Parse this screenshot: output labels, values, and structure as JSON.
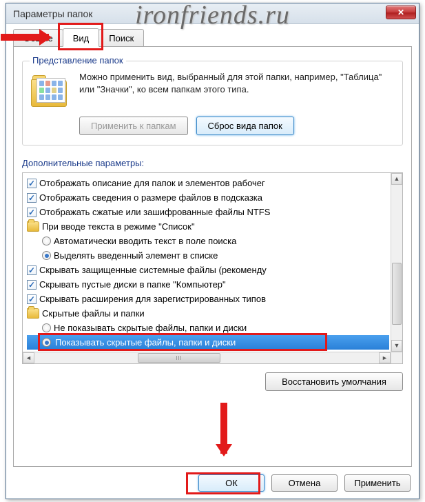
{
  "watermark": "ironfriends.ru",
  "window": {
    "title": "Параметры папок"
  },
  "tabs": {
    "general": "Общие",
    "view": "Вид",
    "search": "Поиск"
  },
  "folder_views": {
    "group_title": "Представление папок",
    "description": "Можно применить вид, выбранный для этой папки, например, \"Таблица\" или \"Значки\", ко всем папкам этого типа.",
    "apply_btn": "Применить к папкам",
    "reset_btn": "Сброс вида папок"
  },
  "advanced": {
    "label": "Дополнительные параметры:",
    "items": [
      {
        "type": "check",
        "indent": 0,
        "checked": true,
        "label": "Отображать описание для папок и элементов рабочег"
      },
      {
        "type": "check",
        "indent": 0,
        "checked": true,
        "label": "Отображать сведения о размере файлов в подсказка"
      },
      {
        "type": "check",
        "indent": 0,
        "checked": true,
        "label": "Отображать сжатые или зашифрованные файлы NTFS"
      },
      {
        "type": "folder",
        "indent": 0,
        "label": "При вводе текста в режиме \"Список\""
      },
      {
        "type": "radio",
        "indent": 1,
        "checked": false,
        "label": "Автоматически вводить текст в поле поиска"
      },
      {
        "type": "radio",
        "indent": 1,
        "checked": true,
        "label": "Выделять введенный элемент в списке"
      },
      {
        "type": "check",
        "indent": 0,
        "checked": true,
        "label": "Скрывать защищенные системные файлы (рекоменду"
      },
      {
        "type": "check",
        "indent": 0,
        "checked": true,
        "label": "Скрывать пустые диски в папке \"Компьютер\""
      },
      {
        "type": "check",
        "indent": 0,
        "checked": true,
        "label": "Скрывать расширения для зарегистрированных типов"
      },
      {
        "type": "folder",
        "indent": 0,
        "label": "Скрытые файлы и папки"
      },
      {
        "type": "radio",
        "indent": 1,
        "checked": false,
        "label": "Не показывать скрытые файлы, папки и диски"
      },
      {
        "type": "radio",
        "indent": 1,
        "checked": true,
        "label": "Показывать скрытые файлы, папки и диски",
        "selected": true
      }
    ],
    "restore_btn": "Восстановить умолчания"
  },
  "buttons": {
    "ok": "ОК",
    "cancel": "Отмена",
    "apply": "Применить"
  }
}
